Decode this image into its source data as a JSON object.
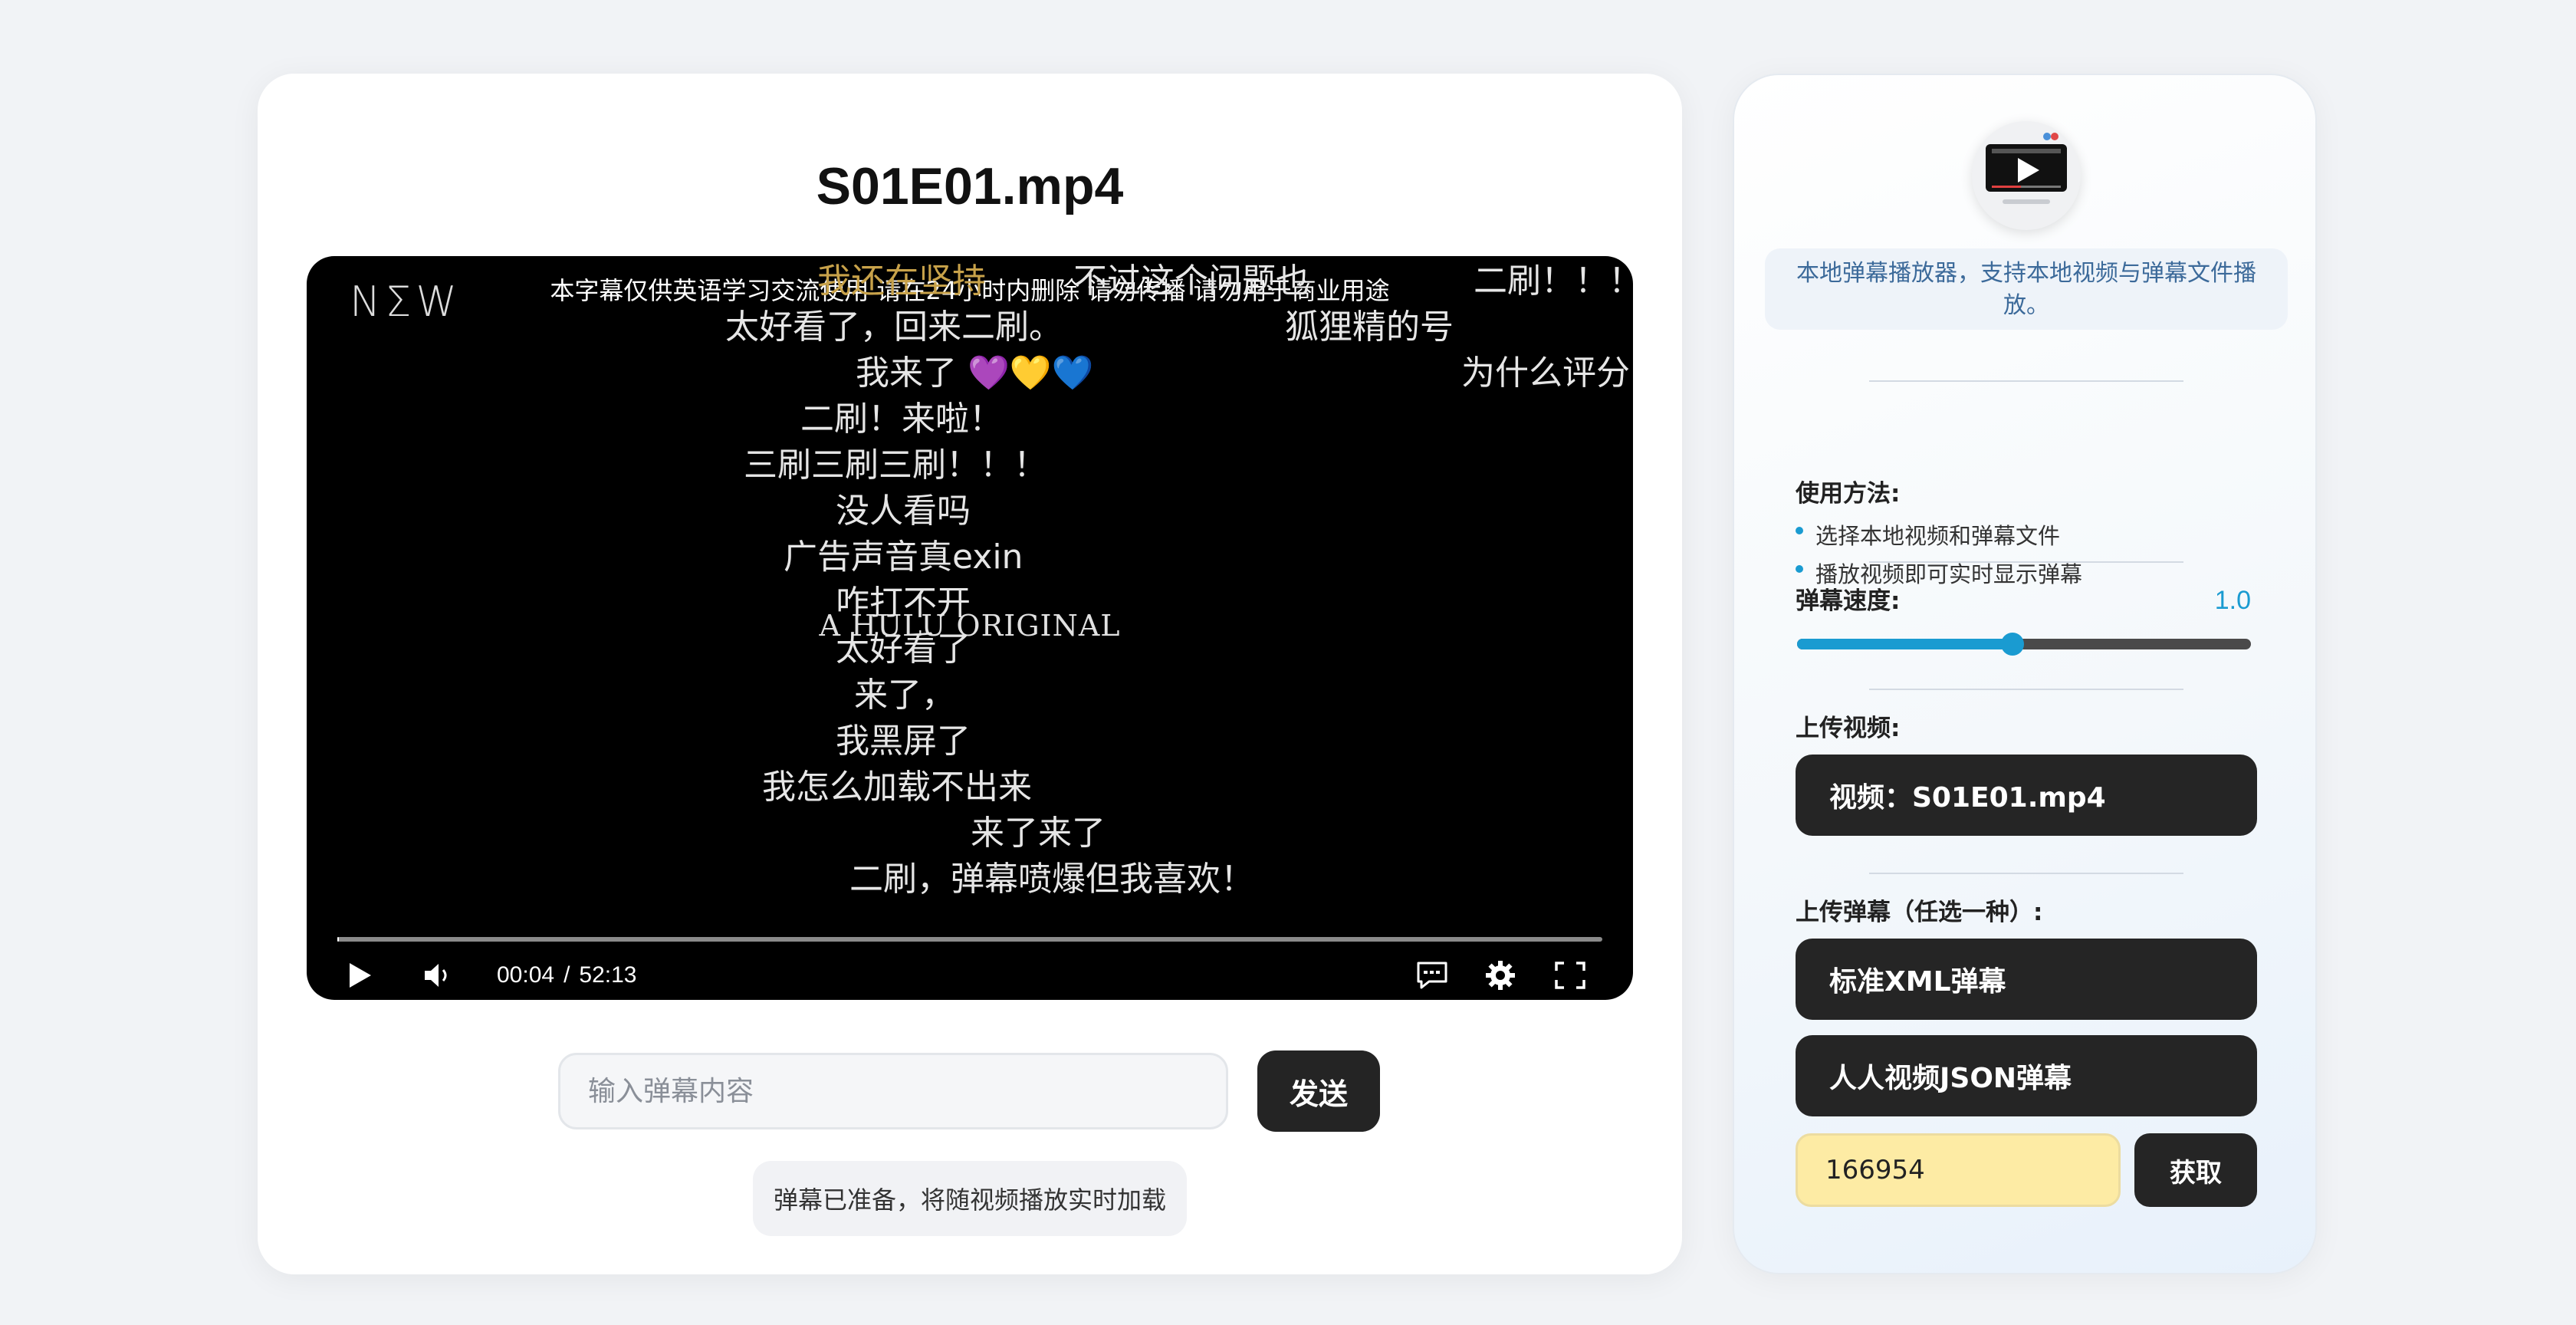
{
  "player": {
    "title": "S01E01.mp4",
    "logo": "NΣW",
    "subtitle_notice": "本字幕仅供英语学习交流使用  请在24小时内删除  请勿传播  请勿用于商业用途",
    "center_brand": "A HULU ORIGINAL",
    "danmaku": [
      {
        "text": "我还在坚持",
        "color": "gold"
      },
      {
        "text": "不过这个问题也"
      },
      {
        "text": "二刷！！！"
      },
      {
        "text": "太好看了，回来二刷。"
      },
      {
        "text": "狐狸精的号"
      },
      {
        "text": "我来了  💜💛💙"
      },
      {
        "text": "为什么评分"
      },
      {
        "text": "二刷！来啦！"
      },
      {
        "text": "三刷三刷三刷！！！"
      },
      {
        "text": "没人看吗"
      },
      {
        "text": "广告声音真exin"
      },
      {
        "text": "咋打不开"
      },
      {
        "text": "太好看了"
      },
      {
        "text": "来了，"
      },
      {
        "text": "我黑屏了"
      },
      {
        "text": "我怎么加载不出来"
      },
      {
        "text": "来了来了"
      },
      {
        "text": "二刷，弹幕喷爆但我喜欢！"
      }
    ],
    "current_time": "00:04",
    "duration": "52:13",
    "time_separator": "/",
    "progress": 0.0013
  },
  "input": {
    "placeholder": "输入弹幕内容",
    "value": "",
    "send_label": "发送"
  },
  "status_text": "弹幕已准备，将随视频播放实时加载",
  "sidebar": {
    "description": "本地弹幕播放器，支持本地视频与弹幕文件播放。",
    "usage_title": "使用方法:",
    "usage_items": [
      "选择本地视频和弹幕文件",
      "播放视频即可实时显示弹幕"
    ],
    "speed_label": "弹幕速度:",
    "speed_value": "1.0",
    "speed_fraction": 0.475,
    "upload_video_label": "上传视频:",
    "video_button": "视频：S01E01.mp4",
    "upload_danmaku_label": "上传弹幕（任选一种）:",
    "xml_button": "标准XML弹幕",
    "json_button": "人人视频JSON弹幕",
    "id_value": "166954",
    "fetch_button": "获取"
  },
  "colors": {
    "accent": "#1a9bd1",
    "dark_button": "#252525",
    "id_input_bg": "#fdeba4",
    "danmaku_gold": "#c8a24a"
  }
}
